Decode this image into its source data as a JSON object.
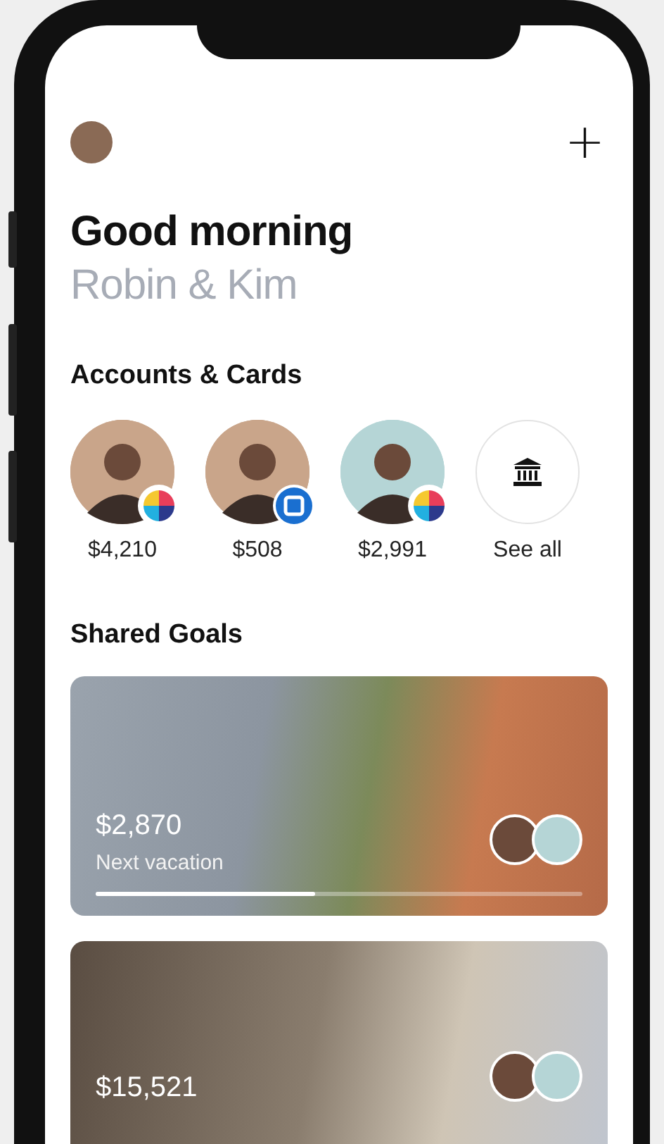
{
  "header": {
    "greeting": "Good morning",
    "names": "Robin & Kim",
    "add_button": "+"
  },
  "accounts": {
    "title": "Accounts & Cards",
    "items": [
      {
        "kind": "person",
        "badge": {
          "kind": "pie"
        },
        "amount": "$4,210",
        "color": "#c9a58a"
      },
      {
        "kind": "person",
        "badge": {
          "kind": "bank"
        },
        "amount": "$508",
        "color": "#c9a58a"
      },
      {
        "kind": "person",
        "badge": {
          "kind": "pie"
        },
        "amount": "$2,991",
        "color": "#b5d5d6"
      },
      {
        "kind": "see-all",
        "amount": "See all",
        "color": "#ffffff"
      }
    ]
  },
  "goals": {
    "title": "Shared Goals",
    "items": [
      {
        "kind": "coast",
        "amount": "$2,870",
        "label": "Next vacation",
        "level": 0.45
      },
      {
        "kind": "bedroom",
        "amount": "$15,521"
      }
    ]
  }
}
